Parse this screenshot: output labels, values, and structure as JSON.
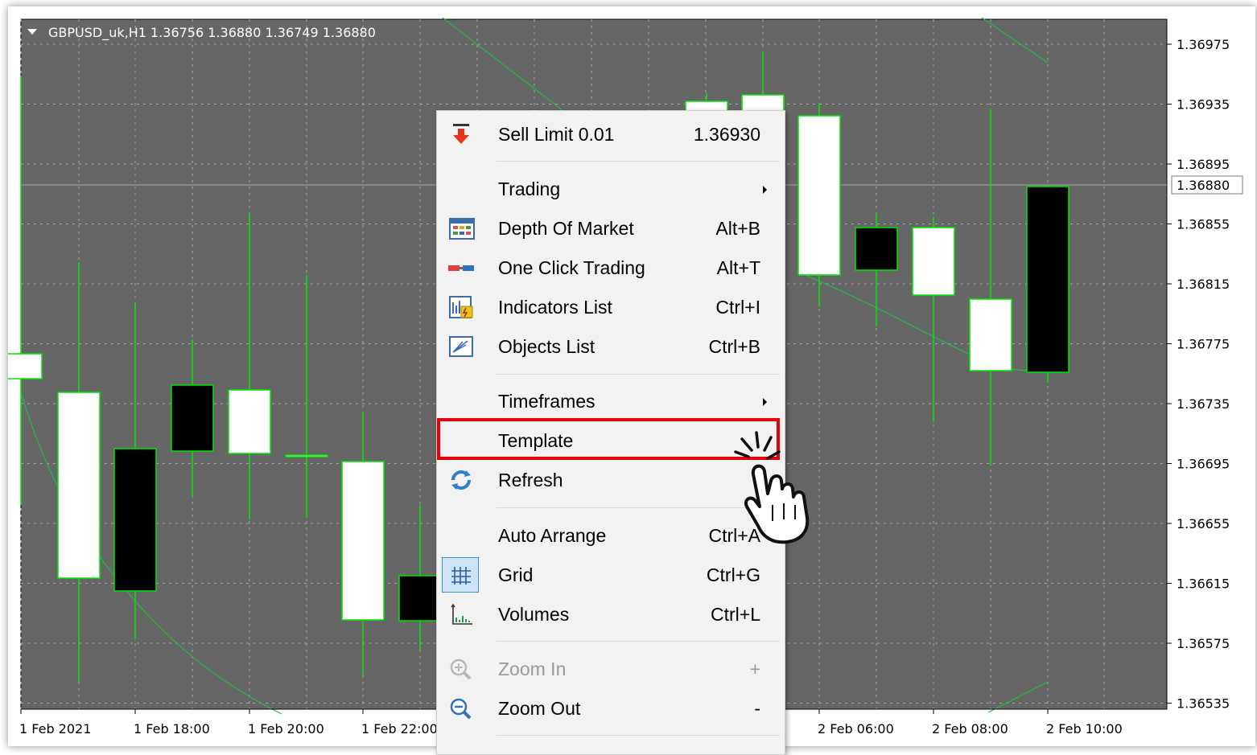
{
  "chart": {
    "symbol_header": "GBPUSD_uk,H1  1.36756 1.36880 1.36749 1.36880",
    "price_labels": [
      "1.36975",
      "1.36935",
      "1.36895",
      "1.36855",
      "1.36815",
      "1.36775",
      "1.36735",
      "1.36695",
      "1.36655",
      "1.36615",
      "1.36575",
      "1.36535"
    ],
    "current_price": "1.36880",
    "time_labels": [
      "1 Feb 2021",
      "1 Feb 18:00",
      "1 Feb 20:00",
      "1 Feb 22:00",
      "2 Feb 06:00",
      "2 Feb 08:00",
      "2 Feb 10:00"
    ],
    "colors": {
      "background": "#666666",
      "wick_and_border": "#00e600",
      "bull_body": "#ffffff",
      "bear_body": "#000000",
      "moving_average": "#22bb44",
      "grid": "#a6a6a6",
      "current_price_line": "#9aa8b8"
    }
  },
  "context_menu": {
    "items": [
      {
        "id": "sell-limit",
        "label": "Sell Limit 0.01",
        "shortcut": "1.36930",
        "icon": "sell-limit-arrow-icon"
      },
      {
        "id": "trading",
        "label": "Trading",
        "submenu": true
      },
      {
        "id": "depth-of-market",
        "label": "Depth Of Market",
        "shortcut": "Alt+B",
        "icon": "depth-of-market-icon"
      },
      {
        "id": "one-click-trading",
        "label": "One Click Trading",
        "shortcut": "Alt+T",
        "icon": "one-click-trading-icon"
      },
      {
        "id": "indicators-list",
        "label": "Indicators List",
        "shortcut": "Ctrl+I",
        "icon": "indicators-list-icon"
      },
      {
        "id": "objects-list",
        "label": "Objects List",
        "shortcut": "Ctrl+B",
        "icon": "objects-list-icon"
      },
      {
        "id": "timeframes",
        "label": "Timeframes",
        "submenu": true
      },
      {
        "id": "template",
        "label": "Template",
        "submenu": true,
        "highlighted": true
      },
      {
        "id": "refresh",
        "label": "Refresh",
        "icon": "refresh-icon"
      },
      {
        "id": "auto-arrange",
        "label": "Auto Arrange",
        "shortcut": "Ctrl+A"
      },
      {
        "id": "grid",
        "label": "Grid",
        "shortcut": "Ctrl+G",
        "icon": "grid-icon",
        "checked": true
      },
      {
        "id": "volumes",
        "label": "Volumes",
        "shortcut": "Ctrl+L",
        "icon": "volumes-icon"
      },
      {
        "id": "zoom-in",
        "label": "Zoom In",
        "shortcut": "+",
        "icon": "zoom-in-icon",
        "disabled": true
      },
      {
        "id": "zoom-out",
        "label": "Zoom Out",
        "shortcut": "-",
        "icon": "zoom-out-icon"
      }
    ],
    "highlight_color": "#e8000b"
  }
}
